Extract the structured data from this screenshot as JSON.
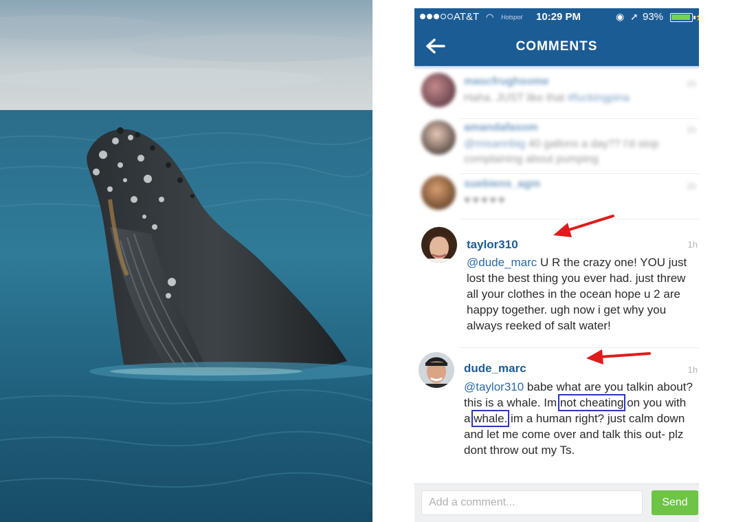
{
  "status_bar": {
    "carrier": "AT&T",
    "hotspot_label": "Hotspot",
    "time": "10:29 PM",
    "battery": "93%"
  },
  "header": {
    "title": "COMMENTS"
  },
  "blurred_comments": [
    {
      "username": "mascfrughsome",
      "text_plain": "Haha. JUST like that ",
      "text_tag": "#fuckingpina",
      "time": "1h"
    },
    {
      "username": "amandafasom",
      "text_tag": "@misannbig",
      "text_plain": " 40 gallons a day?? I'd stop complaining about pumping",
      "time": "1h"
    },
    {
      "username": "suebiens_agm",
      "text_plain": "♥♥♥♥♥",
      "time": "1h"
    }
  ],
  "comments": [
    {
      "username": "taylor310",
      "time": "1h",
      "mention": "@dude_marc",
      "text": " U R the crazy one! YOU just lost the best thing you ever had. just threw all your clothes in the ocean hope u 2 are happy together. ugh now i get why you always reeked of salt water!"
    },
    {
      "username": "dude_marc",
      "time": "1h",
      "mention": "@taylor310",
      "text_1": " babe what are you talkin about? this is a whale. Im ",
      "highlight_1": "not cheating",
      "text_2": " on you with a ",
      "highlight_2": "whale.",
      "text_3": " im a human right? just calm down and let me come over and talk this out- plz dont throw out my Ts."
    }
  ],
  "comment_input": {
    "placeholder": "Add a comment..."
  },
  "send_button": {
    "label": "Send"
  },
  "colors": {
    "header_blue": "#1c5c95",
    "username_blue": "#1c5c95",
    "send_green": "#6dc445",
    "arrow_red": "#e01b1b",
    "highlight_box": "#2b35b8"
  }
}
